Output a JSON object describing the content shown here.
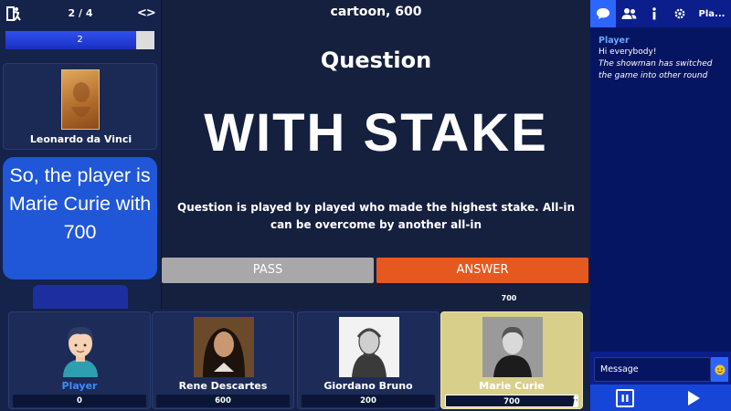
{
  "header": {
    "round_counter": "2 / 4",
    "round_nav": "<>",
    "theme_title": "cartoon, 600"
  },
  "timer": {
    "value": "2",
    "progress": 0.88
  },
  "showman": {
    "name": "Leonardo da Vinci"
  },
  "speech_bubble": {
    "text": "So, the player is Marie Curie with 700"
  },
  "question": {
    "label": "Question",
    "type": "WITH STAKE",
    "description": "Question is played by played who made the highest stake. All-in can be overcome by another all-in"
  },
  "actions": {
    "pass_label": "PASS",
    "answer_label": "ANSWER"
  },
  "stake": {
    "value": "700"
  },
  "players": [
    {
      "name": "Player",
      "score": "0",
      "active": false,
      "name_color": "#3d8bff"
    },
    {
      "name": "Rene Descartes",
      "score": "600",
      "active": false,
      "name_color": "#ffffff"
    },
    {
      "name": "Giordano Bruno",
      "score": "200",
      "active": false,
      "name_color": "#ffffff"
    },
    {
      "name": "Marie Curie",
      "score": "700",
      "active": true,
      "name_color": "#ffffff"
    }
  ],
  "chat": {
    "tabs": [
      "chat-icon",
      "players-icon",
      "info-icon",
      "settings-icon",
      "Pla..."
    ],
    "sender": "Player",
    "message": "Hi everybody!",
    "system_message": "The showman has switched the game into other round",
    "input_placeholder": "Message"
  },
  "colors": {
    "background": "#0d1533",
    "accent_blue": "#2d66ff",
    "answer_orange": "#e5581f",
    "pass_gray": "#a8a8a8",
    "active_player_gold": "#d8cf8a"
  }
}
